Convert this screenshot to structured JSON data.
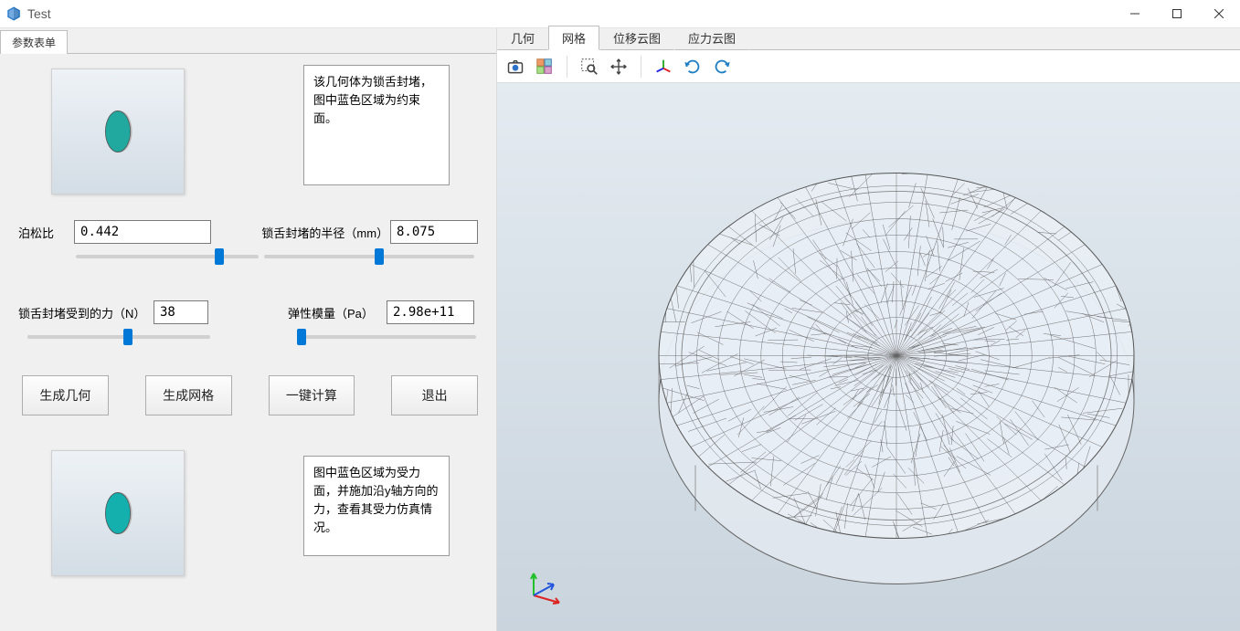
{
  "window": {
    "title": "Test"
  },
  "panel": {
    "tab": "参数表单",
    "note1": "该几何体为锁舌封堵，图中蓝色区域为约束面。",
    "note2": "图中蓝色区域为受力面，并施加沿y轴方向的力，查看其受力仿真情况。"
  },
  "params": {
    "poisson_label": "泊松比",
    "poisson_value": "0.442",
    "radius_label": "锁舌封堵的半径（mm）",
    "radius_value": "8.075",
    "force_label": "锁舌封堵受到的力（N）",
    "force_value": "38",
    "modulus_label": "弹性模量（Pa）",
    "modulus_value": "2.98e+11"
  },
  "buttons": {
    "gen_geom": "生成几何",
    "gen_mesh": "生成网格",
    "calc": "一键计算",
    "exit": "退出"
  },
  "view_tabs": {
    "geom": "几何",
    "mesh": "网格",
    "disp": "位移云图",
    "stress": "应力云图"
  },
  "toolbar_icons": {
    "camera": "camera",
    "select_cells": "select-cells",
    "zoom_area": "zoom-area",
    "pan": "pan",
    "axis_triad": "axis-triad",
    "rotate_ccw": "rotate-ccw",
    "rotate_cw": "rotate-cw"
  }
}
